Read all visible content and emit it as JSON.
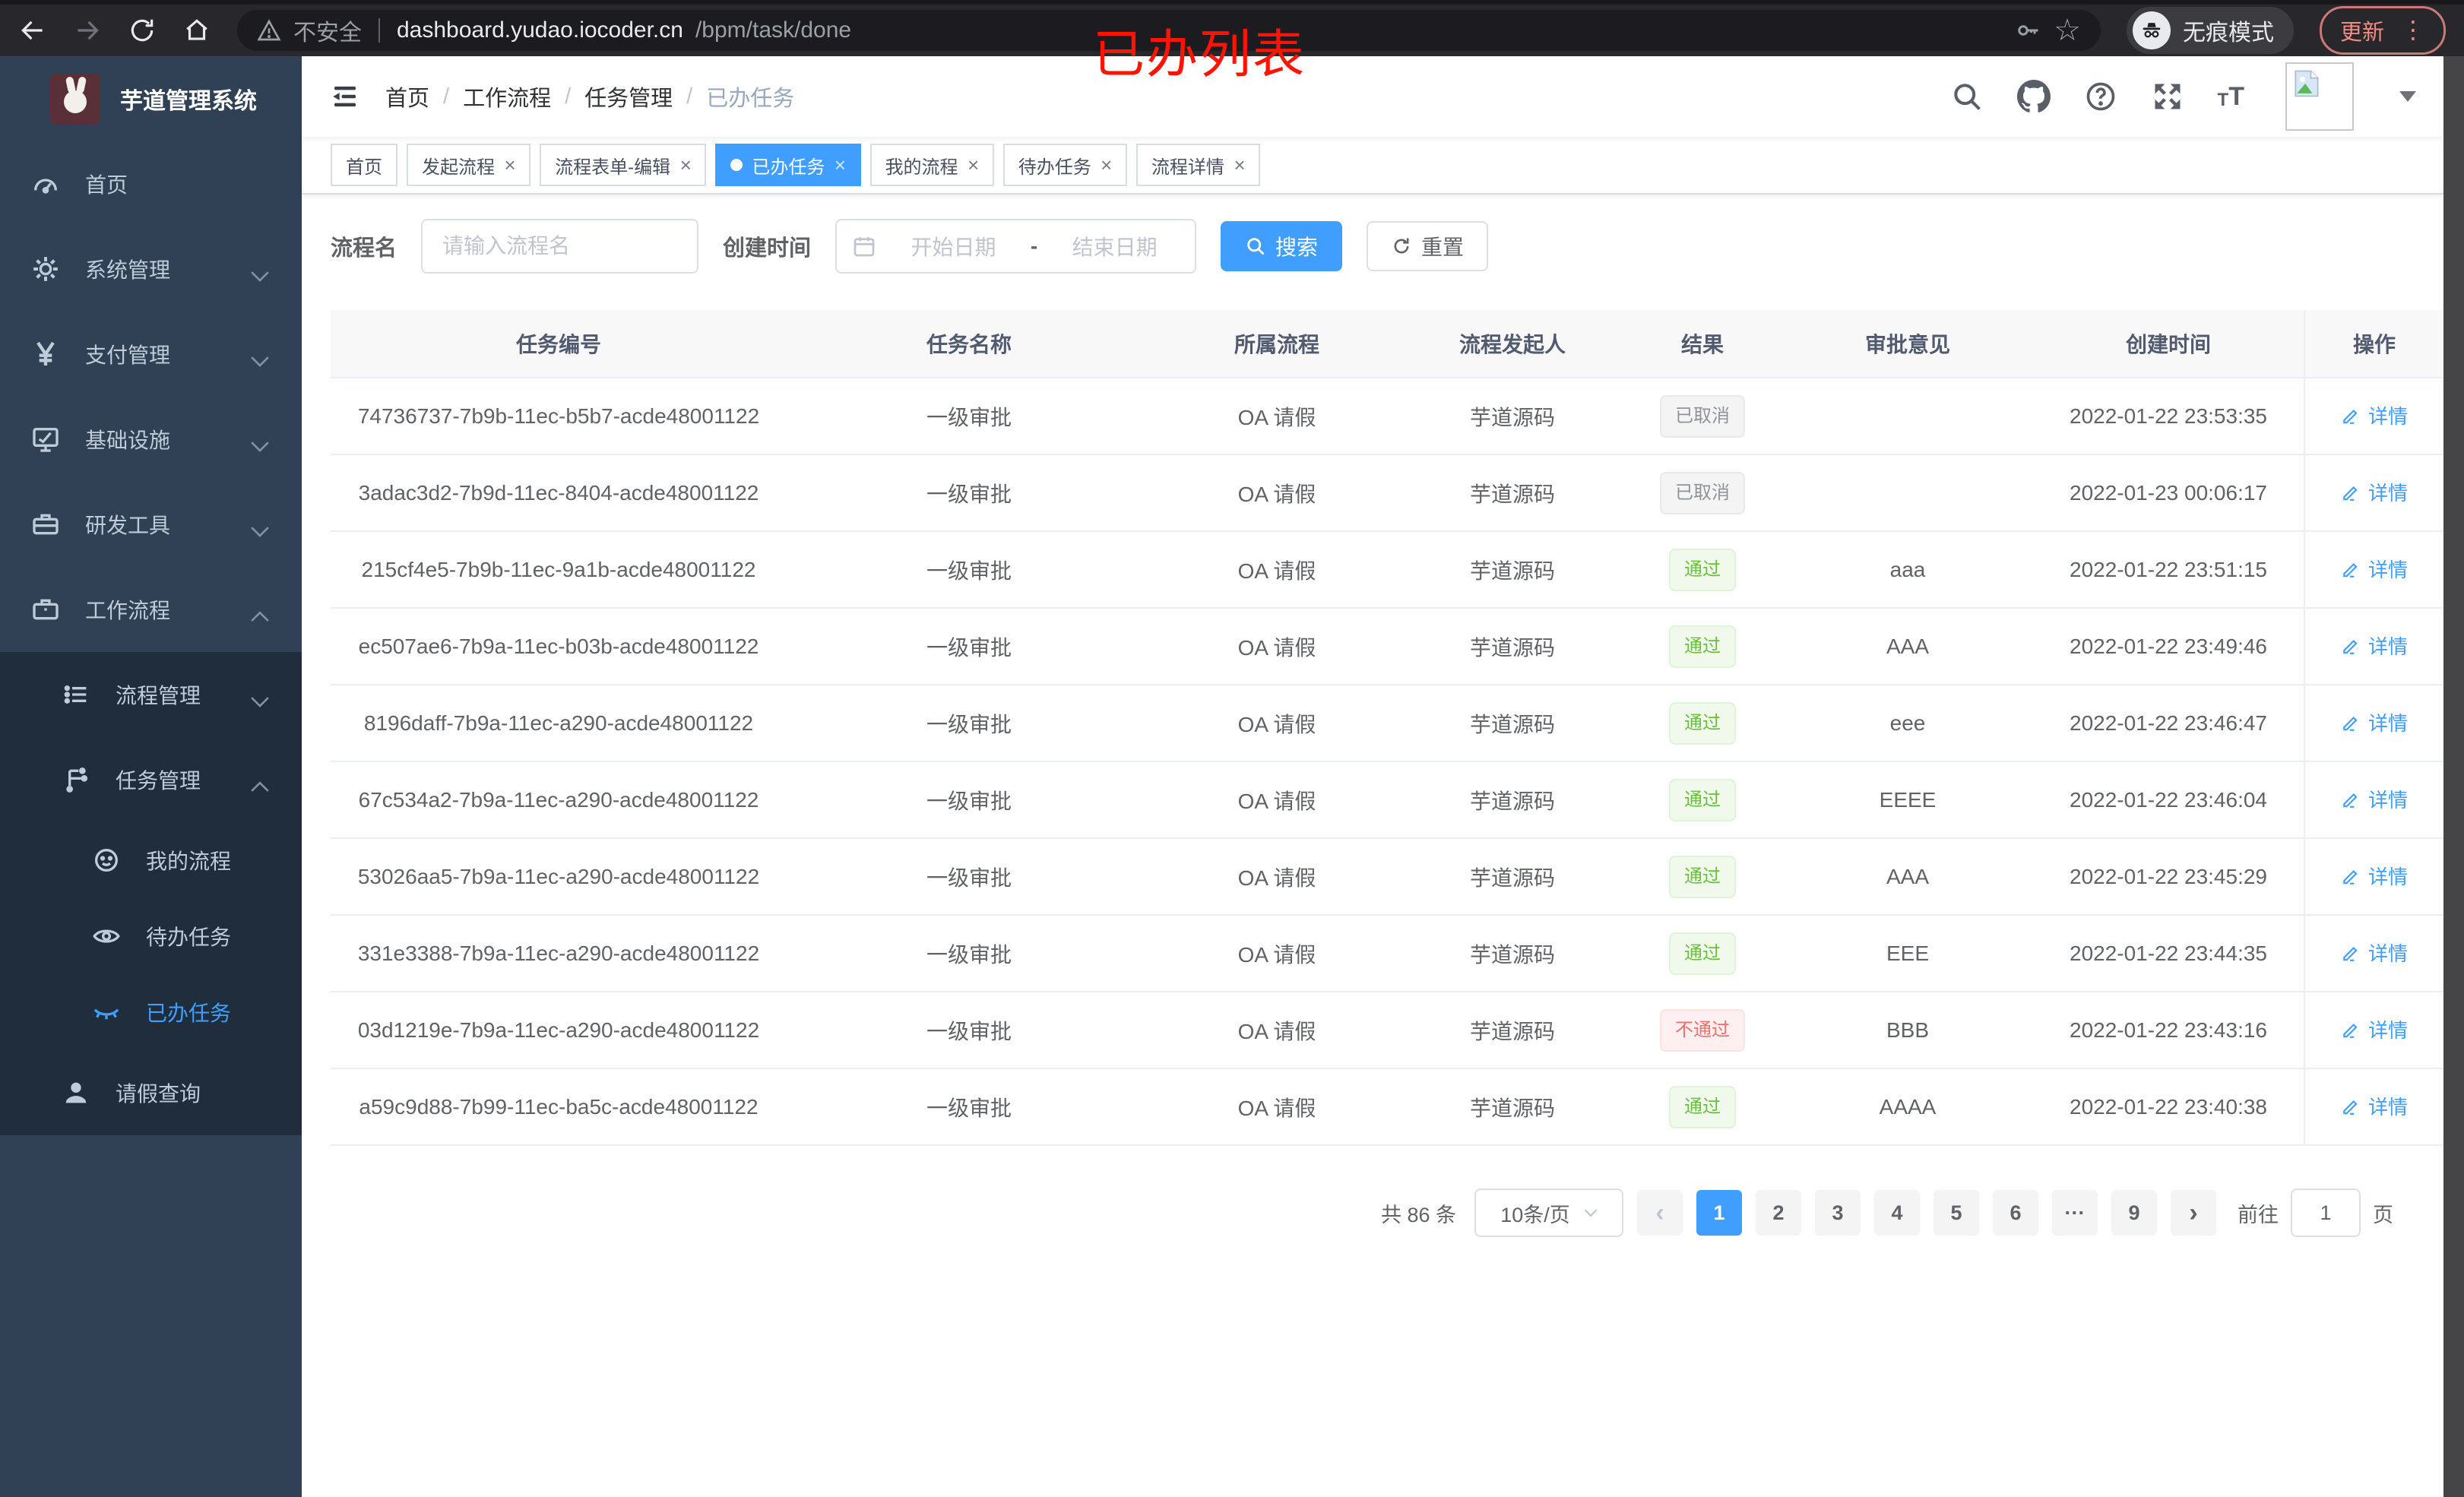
{
  "browser": {
    "security_text": "不安全",
    "url_host": "dashboard.yudao.iocoder.cn",
    "url_path": "/bpm/task/done",
    "incognito_label": "无痕模式",
    "update_label": "更新"
  },
  "overlay_title": "已办列表",
  "icons": {
    "star": "☆",
    "more_vertical": "⋮",
    "close_tab": "×",
    "breadcrumb_separator": "/",
    "range_separator": "-",
    "prev_arrow": "‹",
    "next_arrow": "›"
  },
  "colors": {
    "primary": "#409EFF",
    "success": "#67C23A",
    "danger": "#F56C6C",
    "info": "#909399",
    "sidebar_bg": "#304156",
    "submenu_bg": "#1f2d3d",
    "overlay_title": "#FE1400"
  },
  "sidebar": {
    "logo_title": "芋道管理系统",
    "items": [
      {
        "label": "首页"
      },
      {
        "label": "系统管理"
      },
      {
        "label": "支付管理"
      },
      {
        "label": "基础设施"
      },
      {
        "label": "研发工具"
      },
      {
        "label": "工作流程"
      },
      {
        "label": "流程管理"
      },
      {
        "label": "任务管理"
      },
      {
        "label": "我的流程"
      },
      {
        "label": "待办任务"
      },
      {
        "label": "已办任务"
      },
      {
        "label": "请假查询"
      }
    ]
  },
  "breadcrumb": {
    "items": [
      {
        "label": "首页",
        "last": false
      },
      {
        "label": "工作流程",
        "last": false
      },
      {
        "label": "任务管理",
        "last": false
      },
      {
        "label": "已办任务",
        "last": true
      }
    ]
  },
  "tabs": [
    {
      "label": "首页",
      "closable": false,
      "active": false
    },
    {
      "label": "发起流程",
      "closable": true,
      "active": false
    },
    {
      "label": "流程表单-编辑",
      "closable": true,
      "active": false
    },
    {
      "label": "已办任务",
      "closable": true,
      "active": true
    },
    {
      "label": "我的流程",
      "closable": true,
      "active": false
    },
    {
      "label": "待办任务",
      "closable": true,
      "active": false
    },
    {
      "label": "流程详情",
      "closable": true,
      "active": false
    }
  ],
  "filters": {
    "name_label": "流程名",
    "name_placeholder": "请输入流程名",
    "time_label": "创建时间",
    "start_placeholder": "开始日期",
    "end_placeholder": "结束日期",
    "search_label": "搜索",
    "reset_label": "重置"
  },
  "table": {
    "columns": [
      "任务编号",
      "任务名称",
      "所属流程",
      "流程发起人",
      "结果",
      "审批意见",
      "创建时间",
      "操作"
    ],
    "action_label": "详情",
    "rows": [
      {
        "id": "74736737-7b9b-11ec-b5b7-acde48001122",
        "name": "一级审批",
        "process": "OA 请假",
        "starter": "芋道源码",
        "result": "已取消",
        "result_type": "info",
        "opinion": "",
        "created": "2022-01-22 23:53:35"
      },
      {
        "id": "3adac3d2-7b9d-11ec-8404-acde48001122",
        "name": "一级审批",
        "process": "OA 请假",
        "starter": "芋道源码",
        "result": "已取消",
        "result_type": "info",
        "opinion": "",
        "created": "2022-01-23 00:06:17"
      },
      {
        "id": "215cf4e5-7b9b-11ec-9a1b-acde48001122",
        "name": "一级审批",
        "process": "OA 请假",
        "starter": "芋道源码",
        "result": "通过",
        "result_type": "success",
        "opinion": "aaa",
        "created": "2022-01-22 23:51:15"
      },
      {
        "id": "ec507ae6-7b9a-11ec-b03b-acde48001122",
        "name": "一级审批",
        "process": "OA 请假",
        "starter": "芋道源码",
        "result": "通过",
        "result_type": "success",
        "opinion": "AAA",
        "created": "2022-01-22 23:49:46"
      },
      {
        "id": "8196daff-7b9a-11ec-a290-acde48001122",
        "name": "一级审批",
        "process": "OA 请假",
        "starter": "芋道源码",
        "result": "通过",
        "result_type": "success",
        "opinion": "eee",
        "created": "2022-01-22 23:46:47"
      },
      {
        "id": "67c534a2-7b9a-11ec-a290-acde48001122",
        "name": "一级审批",
        "process": "OA 请假",
        "starter": "芋道源码",
        "result": "通过",
        "result_type": "success",
        "opinion": "EEEE",
        "created": "2022-01-22 23:46:04"
      },
      {
        "id": "53026aa5-7b9a-11ec-a290-acde48001122",
        "name": "一级审批",
        "process": "OA 请假",
        "starter": "芋道源码",
        "result": "通过",
        "result_type": "success",
        "opinion": "AAA",
        "created": "2022-01-22 23:45:29"
      },
      {
        "id": "331e3388-7b9a-11ec-a290-acde48001122",
        "name": "一级审批",
        "process": "OA 请假",
        "starter": "芋道源码",
        "result": "通过",
        "result_type": "success",
        "opinion": "EEE",
        "created": "2022-01-22 23:44:35"
      },
      {
        "id": "03d1219e-7b9a-11ec-a290-acde48001122",
        "name": "一级审批",
        "process": "OA 请假",
        "starter": "芋道源码",
        "result": "不通过",
        "result_type": "danger",
        "opinion": "BBB",
        "created": "2022-01-22 23:43:16"
      },
      {
        "id": "a59c9d88-7b99-11ec-ba5c-acde48001122",
        "name": "一级审批",
        "process": "OA 请假",
        "starter": "芋道源码",
        "result": "通过",
        "result_type": "success",
        "opinion": "AAAA",
        "created": "2022-01-22 23:40:38"
      }
    ]
  },
  "pagination": {
    "total_label": "共 86 条",
    "page_size_label": "10条/页",
    "pages": [
      {
        "label": "1",
        "active": true
      },
      {
        "label": "2",
        "active": false
      },
      {
        "label": "3",
        "active": false
      },
      {
        "label": "4",
        "active": false
      },
      {
        "label": "5",
        "active": false
      },
      {
        "label": "6",
        "active": false
      },
      {
        "label": "···",
        "active": false
      },
      {
        "label": "9",
        "active": false
      }
    ],
    "goto_label": "前往",
    "goto_value": "1",
    "unit_label": "页"
  }
}
